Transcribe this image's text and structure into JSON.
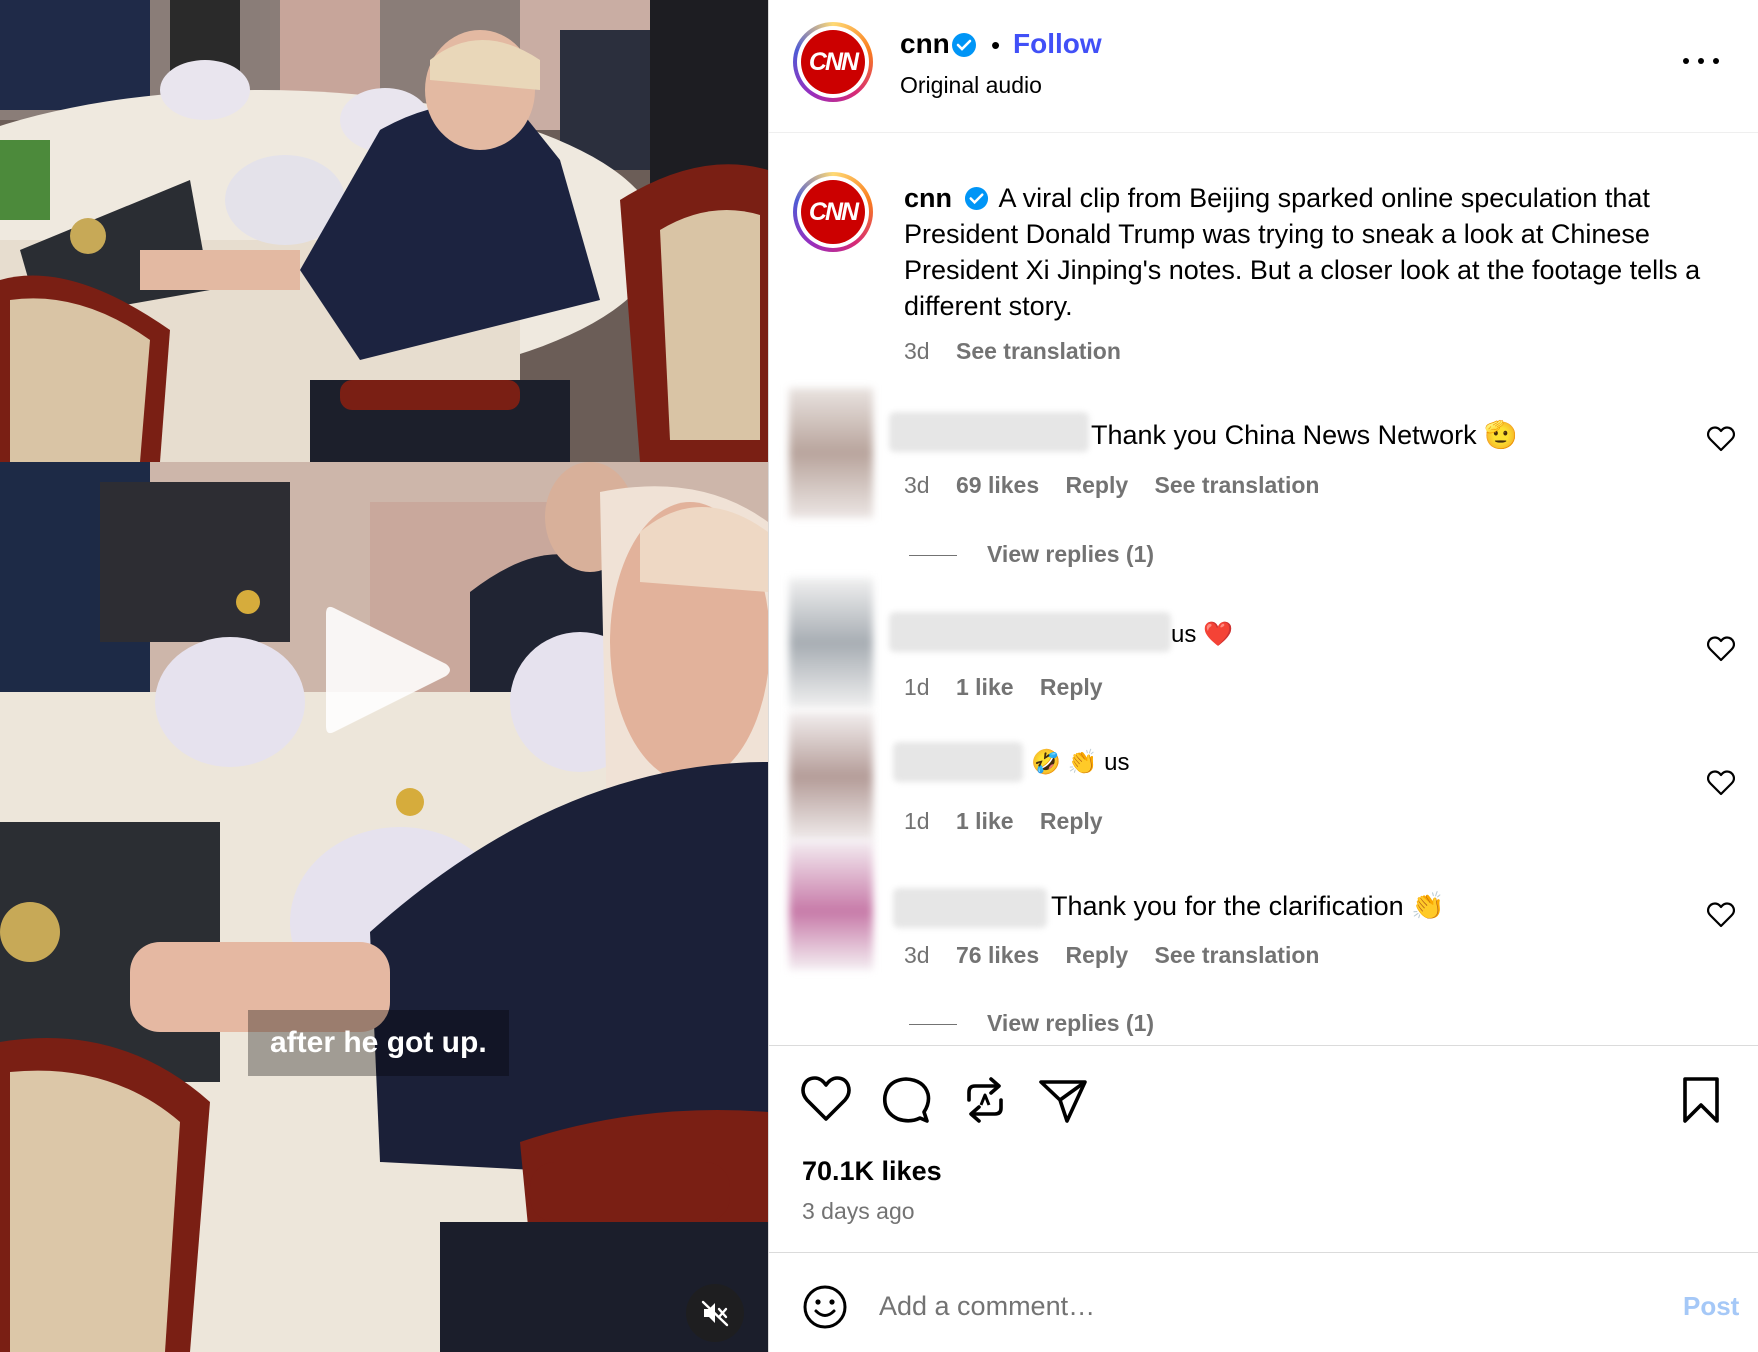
{
  "video": {
    "caption_text": "after he got up.",
    "play_icon": "play-icon",
    "mute_icon": "speaker-muted-icon"
  },
  "header": {
    "avatar_logo": "CNN",
    "username": "cnn",
    "separator": "•",
    "follow_label": "Follow",
    "audio_label": "Original audio",
    "verified_icon": "verified-badge-icon",
    "more_icon": "more-options-icon"
  },
  "caption": {
    "username": "cnn",
    "text": "A viral clip from Beijing sparked online speculation that President Donald Trump was trying to sneak a look at Chinese President Xi Jinping's notes. But a closer look at the footage tells a different story.",
    "time": "3d",
    "translate_label": "See translation"
  },
  "comments": [
    {
      "text": "Thank you China News Network 🫡",
      "time": "3d",
      "likes": "69 likes",
      "reply_label": "Reply",
      "translate_label": "See translation",
      "view_replies": "View replies (1)"
    },
    {
      "text": "us ❤️",
      "time": "1d",
      "likes": "1 like",
      "reply_label": "Reply"
    },
    {
      "text": "🤣 👏 us",
      "time": "1d",
      "likes": "1 like",
      "reply_label": "Reply"
    },
    {
      "text": "Thank you for the clarification 👏",
      "time": "3d",
      "likes": "76 likes",
      "reply_label": "Reply",
      "translate_label": "See translation",
      "view_replies": "View replies (1)"
    }
  ],
  "actions": {
    "like_icon": "heart-icon",
    "comment_icon": "comment-bubble-icon",
    "repost_icon": "repost-icon",
    "share_icon": "share-paper-plane-icon",
    "save_icon": "bookmark-icon"
  },
  "post": {
    "likes": "70.1K likes",
    "time": "3 days ago"
  },
  "comment_bar": {
    "emoji_icon": "emoji-smile-icon",
    "placeholder": "Add a comment…",
    "post_label": "Post"
  },
  "colors": {
    "accent": "#4150f7",
    "muted": "#737373",
    "cnn_red": "#cc0000",
    "post_disabled": "#a5c8f7"
  }
}
